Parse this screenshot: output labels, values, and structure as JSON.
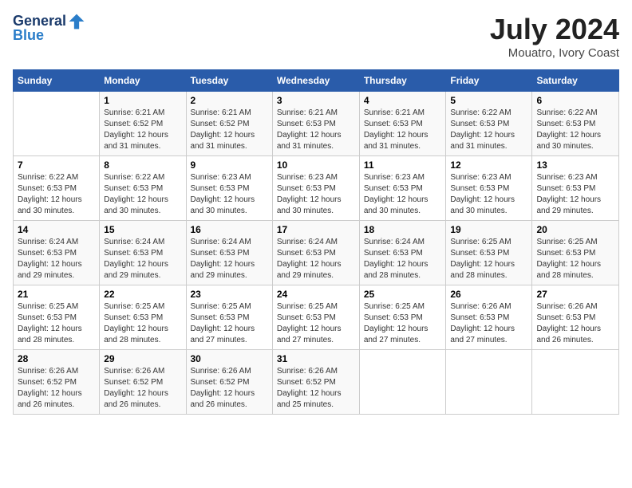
{
  "header": {
    "logo_line1": "General",
    "logo_line2": "Blue",
    "month_year": "July 2024",
    "location": "Mouatro, Ivory Coast"
  },
  "days_of_week": [
    "Sunday",
    "Monday",
    "Tuesday",
    "Wednesday",
    "Thursday",
    "Friday",
    "Saturday"
  ],
  "weeks": [
    [
      {
        "day": "",
        "sunrise": "",
        "sunset": "",
        "daylight": ""
      },
      {
        "day": "1",
        "sunrise": "Sunrise: 6:21 AM",
        "sunset": "Sunset: 6:52 PM",
        "daylight": "Daylight: 12 hours and 31 minutes."
      },
      {
        "day": "2",
        "sunrise": "Sunrise: 6:21 AM",
        "sunset": "Sunset: 6:52 PM",
        "daylight": "Daylight: 12 hours and 31 minutes."
      },
      {
        "day": "3",
        "sunrise": "Sunrise: 6:21 AM",
        "sunset": "Sunset: 6:53 PM",
        "daylight": "Daylight: 12 hours and 31 minutes."
      },
      {
        "day": "4",
        "sunrise": "Sunrise: 6:21 AM",
        "sunset": "Sunset: 6:53 PM",
        "daylight": "Daylight: 12 hours and 31 minutes."
      },
      {
        "day": "5",
        "sunrise": "Sunrise: 6:22 AM",
        "sunset": "Sunset: 6:53 PM",
        "daylight": "Daylight: 12 hours and 31 minutes."
      },
      {
        "day": "6",
        "sunrise": "Sunrise: 6:22 AM",
        "sunset": "Sunset: 6:53 PM",
        "daylight": "Daylight: 12 hours and 30 minutes."
      }
    ],
    [
      {
        "day": "7",
        "sunrise": "Sunrise: 6:22 AM",
        "sunset": "Sunset: 6:53 PM",
        "daylight": "Daylight: 12 hours and 30 minutes."
      },
      {
        "day": "8",
        "sunrise": "Sunrise: 6:22 AM",
        "sunset": "Sunset: 6:53 PM",
        "daylight": "Daylight: 12 hours and 30 minutes."
      },
      {
        "day": "9",
        "sunrise": "Sunrise: 6:23 AM",
        "sunset": "Sunset: 6:53 PM",
        "daylight": "Daylight: 12 hours and 30 minutes."
      },
      {
        "day": "10",
        "sunrise": "Sunrise: 6:23 AM",
        "sunset": "Sunset: 6:53 PM",
        "daylight": "Daylight: 12 hours and 30 minutes."
      },
      {
        "day": "11",
        "sunrise": "Sunrise: 6:23 AM",
        "sunset": "Sunset: 6:53 PM",
        "daylight": "Daylight: 12 hours and 30 minutes."
      },
      {
        "day": "12",
        "sunrise": "Sunrise: 6:23 AM",
        "sunset": "Sunset: 6:53 PM",
        "daylight": "Daylight: 12 hours and 30 minutes."
      },
      {
        "day": "13",
        "sunrise": "Sunrise: 6:23 AM",
        "sunset": "Sunset: 6:53 PM",
        "daylight": "Daylight: 12 hours and 29 minutes."
      }
    ],
    [
      {
        "day": "14",
        "sunrise": "Sunrise: 6:24 AM",
        "sunset": "Sunset: 6:53 PM",
        "daylight": "Daylight: 12 hours and 29 minutes."
      },
      {
        "day": "15",
        "sunrise": "Sunrise: 6:24 AM",
        "sunset": "Sunset: 6:53 PM",
        "daylight": "Daylight: 12 hours and 29 minutes."
      },
      {
        "day": "16",
        "sunrise": "Sunrise: 6:24 AM",
        "sunset": "Sunset: 6:53 PM",
        "daylight": "Daylight: 12 hours and 29 minutes."
      },
      {
        "day": "17",
        "sunrise": "Sunrise: 6:24 AM",
        "sunset": "Sunset: 6:53 PM",
        "daylight": "Daylight: 12 hours and 29 minutes."
      },
      {
        "day": "18",
        "sunrise": "Sunrise: 6:24 AM",
        "sunset": "Sunset: 6:53 PM",
        "daylight": "Daylight: 12 hours and 28 minutes."
      },
      {
        "day": "19",
        "sunrise": "Sunrise: 6:25 AM",
        "sunset": "Sunset: 6:53 PM",
        "daylight": "Daylight: 12 hours and 28 minutes."
      },
      {
        "day": "20",
        "sunrise": "Sunrise: 6:25 AM",
        "sunset": "Sunset: 6:53 PM",
        "daylight": "Daylight: 12 hours and 28 minutes."
      }
    ],
    [
      {
        "day": "21",
        "sunrise": "Sunrise: 6:25 AM",
        "sunset": "Sunset: 6:53 PM",
        "daylight": "Daylight: 12 hours and 28 minutes."
      },
      {
        "day": "22",
        "sunrise": "Sunrise: 6:25 AM",
        "sunset": "Sunset: 6:53 PM",
        "daylight": "Daylight: 12 hours and 28 minutes."
      },
      {
        "day": "23",
        "sunrise": "Sunrise: 6:25 AM",
        "sunset": "Sunset: 6:53 PM",
        "daylight": "Daylight: 12 hours and 27 minutes."
      },
      {
        "day": "24",
        "sunrise": "Sunrise: 6:25 AM",
        "sunset": "Sunset: 6:53 PM",
        "daylight": "Daylight: 12 hours and 27 minutes."
      },
      {
        "day": "25",
        "sunrise": "Sunrise: 6:25 AM",
        "sunset": "Sunset: 6:53 PM",
        "daylight": "Daylight: 12 hours and 27 minutes."
      },
      {
        "day": "26",
        "sunrise": "Sunrise: 6:26 AM",
        "sunset": "Sunset: 6:53 PM",
        "daylight": "Daylight: 12 hours and 27 minutes."
      },
      {
        "day": "27",
        "sunrise": "Sunrise: 6:26 AM",
        "sunset": "Sunset: 6:53 PM",
        "daylight": "Daylight: 12 hours and 26 minutes."
      }
    ],
    [
      {
        "day": "28",
        "sunrise": "Sunrise: 6:26 AM",
        "sunset": "Sunset: 6:52 PM",
        "daylight": "Daylight: 12 hours and 26 minutes."
      },
      {
        "day": "29",
        "sunrise": "Sunrise: 6:26 AM",
        "sunset": "Sunset: 6:52 PM",
        "daylight": "Daylight: 12 hours and 26 minutes."
      },
      {
        "day": "30",
        "sunrise": "Sunrise: 6:26 AM",
        "sunset": "Sunset: 6:52 PM",
        "daylight": "Daylight: 12 hours and 26 minutes."
      },
      {
        "day": "31",
        "sunrise": "Sunrise: 6:26 AM",
        "sunset": "Sunset: 6:52 PM",
        "daylight": "Daylight: 12 hours and 25 minutes."
      },
      {
        "day": "",
        "sunrise": "",
        "sunset": "",
        "daylight": ""
      },
      {
        "day": "",
        "sunrise": "",
        "sunset": "",
        "daylight": ""
      },
      {
        "day": "",
        "sunrise": "",
        "sunset": "",
        "daylight": ""
      }
    ]
  ]
}
